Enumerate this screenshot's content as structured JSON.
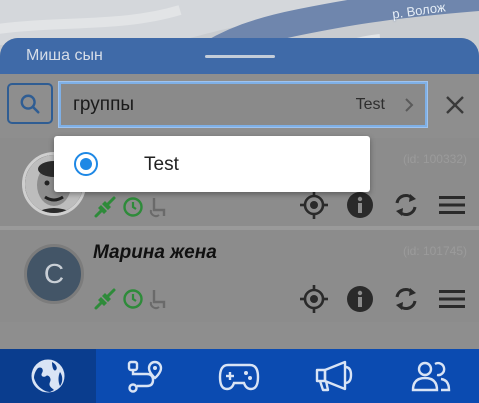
{
  "map": {
    "street_label": "р. Волож"
  },
  "sheet": {
    "title": "Миша сын"
  },
  "search": {
    "value": "группы",
    "selected_option": "Test"
  },
  "dropdown": {
    "options": [
      {
        "label": "Test",
        "selected": true
      }
    ]
  },
  "contacts": [
    {
      "name": "",
      "id_text": "(id: 100332)"
    },
    {
      "name": "Марина жена",
      "id_text": "(id: 101745)",
      "initial": "С"
    }
  ],
  "colors": {
    "header": "#3f6aa8",
    "nav": "#0b4bb1",
    "accent": "#1e88e5",
    "status_green": "#2e8b3a"
  },
  "nav": {
    "items": [
      "globe-icon",
      "route-icon",
      "gamepad-icon",
      "megaphone-icon",
      "people-icon"
    ],
    "active_index": 0
  }
}
